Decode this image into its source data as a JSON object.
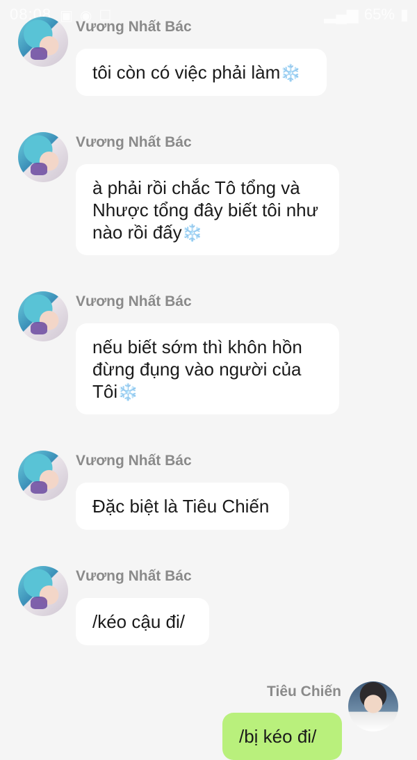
{
  "status_bar": {
    "time": "08:08",
    "battery": "65%"
  },
  "messages": [
    {
      "sender": "Vương Nhất Bác",
      "text": "tôi còn có việc phải làm",
      "emoji": "❄️"
    },
    {
      "sender": "Vương Nhất Bác",
      "text_lines": [
        "à phải rồi chắc Tô tổng và",
        "Nhược tổng đây biết tôi như",
        "nào rồi đấy"
      ],
      "emoji": "❄️"
    },
    {
      "sender": "Vương Nhất Bác",
      "text_lines": [
        "nếu biết sớm thì khôn hồn",
        "đừng đụng vào người của",
        "Tôi"
      ],
      "emoji": "❄️"
    },
    {
      "sender": "Vương Nhất Bác",
      "text": "Đặc biệt là Tiêu Chiến"
    },
    {
      "sender": "Vương Nhất Bác",
      "text": "/kéo cậu đi/"
    },
    {
      "sender": "Tiêu Chiến",
      "text": "/bị kéo đi/"
    }
  ],
  "colors": {
    "background": "#f5f5f5",
    "bubble_incoming": "#ffffff",
    "bubble_outgoing": "#b9f07c",
    "sender_name": "#8a8a8a"
  }
}
